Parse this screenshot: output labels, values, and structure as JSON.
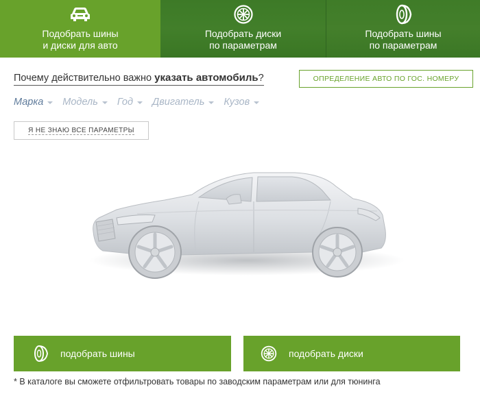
{
  "tabs": [
    {
      "line1": "Подобрать шины",
      "line2": "и диски для авто",
      "icon": "car-icon",
      "active": true
    },
    {
      "line1": "Подобрать диски",
      "line2": "по параметрам",
      "icon": "wheel-rim-icon",
      "active": false
    },
    {
      "line1": "Подобрать шины",
      "line2": "по параметрам",
      "icon": "tire-icon",
      "active": false
    }
  ],
  "heading": {
    "prefix": "Почему действительно важно ",
    "bold": "указать автомобиль",
    "suffix": "?"
  },
  "plate_button": "ОПРЕДЕЛЕНИЕ АВТО ПО ГОС. НОМЕРУ",
  "filters": [
    "Марка",
    "Модель",
    "Год",
    "Двигатель",
    "Кузов"
  ],
  "unknown_button": "Я НЕ ЗНАЮ ВСЕ ПАРАМЕТРЫ",
  "actions": {
    "tires": "подобрать шины",
    "rims": "подобрать диски"
  },
  "note": "* В каталоге вы сможете отфильтровать товары по заводским параметрам или для тюнинга",
  "colors": {
    "accent": "#68a22b",
    "dark_green": "#3f7c28",
    "filter_active": "#5f7b9b",
    "filter_inactive": "#a9b6c6"
  }
}
